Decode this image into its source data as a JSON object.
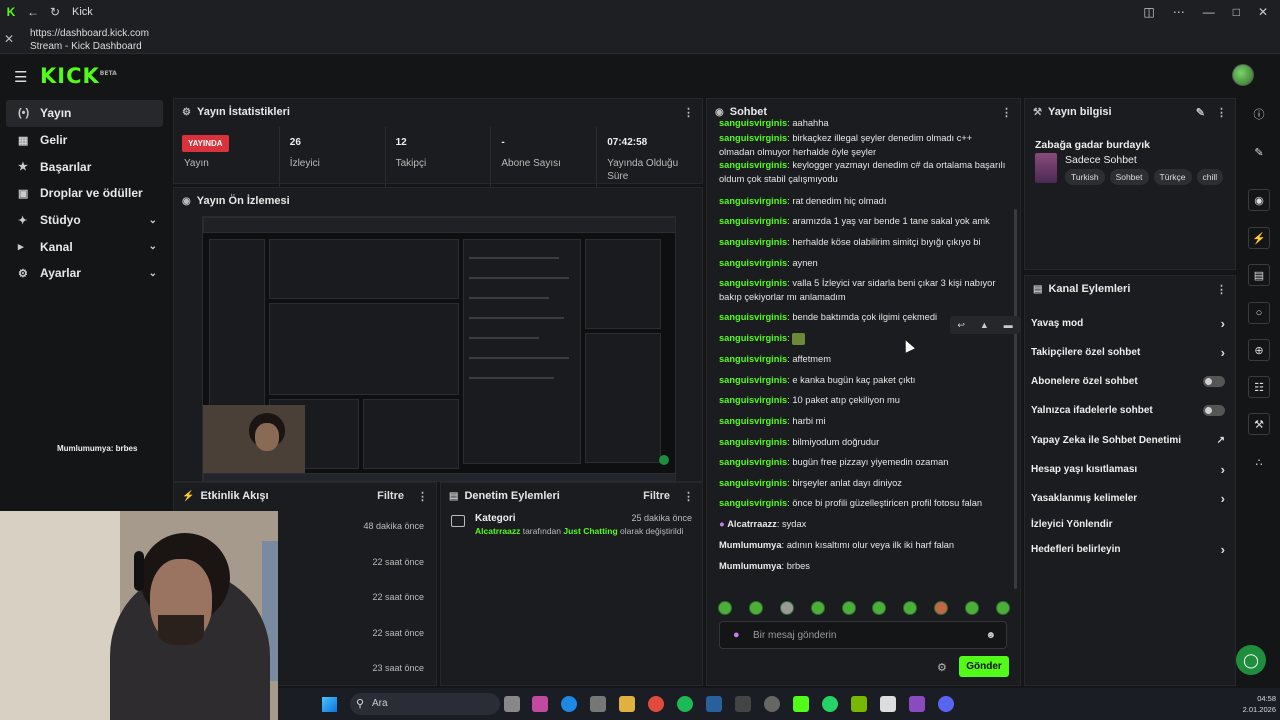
{
  "window": {
    "title": "Kick"
  },
  "address": {
    "url": "https://dashboard.kick.com",
    "page_title": "Stream - Kick Dashboard"
  },
  "brand": {
    "logo": "KICK",
    "logo_suffix": "BETA",
    "accent": "#53fc18"
  },
  "sidebar": {
    "items": [
      {
        "label": "Yayın",
        "icon": "broadcast-icon",
        "active": true
      },
      {
        "label": "Gelir",
        "icon": "money-icon"
      },
      {
        "label": "Başarılar",
        "icon": "trophy-icon"
      },
      {
        "label": "Droplar ve ödüller",
        "icon": "gift-icon"
      },
      {
        "label": "Stüdyo",
        "icon": "studio-icon",
        "expandable": true
      },
      {
        "label": "Kanal",
        "icon": "channel-icon",
        "expandable": true
      },
      {
        "label": "Ayarlar",
        "icon": "gear-icon",
        "expandable": true
      }
    ]
  },
  "overlay_text": "Mumlumumya: brbes",
  "stats_panel": {
    "title": "Yayın İstatistikleri",
    "live_badge": "YAYINDA",
    "stats": [
      {
        "value": "",
        "label": "Yayın"
      },
      {
        "value": "26",
        "label": "İzleyici"
      },
      {
        "value": "12",
        "label": "Takipçi"
      },
      {
        "value": "-",
        "label": "Abone Sayısı"
      },
      {
        "value": "07:42:58",
        "label": "Yayında Olduğu Süre"
      }
    ]
  },
  "preview_panel": {
    "title": "Yayın Ön İzlemesi"
  },
  "activity_panel": {
    "title": "Etkinlik Akışı",
    "filter": "Filtre",
    "times": [
      "48 dakika önce",
      "22 saat önce",
      "22 saat önce",
      "22 saat önce",
      "23 saat önce"
    ]
  },
  "moderation_panel": {
    "title": "Denetim Eylemleri",
    "filter": "Filtre",
    "item": {
      "name": "Kategori",
      "by": "Alcatrraazz",
      "middle": " tarafından ",
      "value": "Just Chatting",
      "suffix": " olarak değiştirildi",
      "time": "25 dakika önce"
    }
  },
  "chat_panel": {
    "title": "Sohbet",
    "messages": [
      {
        "user": "sanguisvirginis",
        "text": "aahahha"
      },
      {
        "user": "sanguisvirginis",
        "text": "birkaçkez illegal şeyler denedim olmadı c++ olmadan olmuyor herhalde öyle şeyler"
      },
      {
        "user": "sanguisvirginis",
        "text": "keylogger yazmayı denedim c# da ortalama başarılı oldum çok stabil çalışmıyodu"
      },
      {
        "user": "sanguisvirginis",
        "text": "rat denedim hiç olmadı"
      },
      {
        "user": "sanguisvirginis",
        "text": "aramızda 1 yaş var bende 1 tane sakal yok amk"
      },
      {
        "user": "sanguisvirginis",
        "text": "herhalde köse olabilirim simitçi bıyığı çıkıyo bi"
      },
      {
        "user": "sanguisvirginis",
        "text": "aynen"
      },
      {
        "user": "sanguisvirginis",
        "text": "valla 5 İzleyici var sidarla beni çıkar 3 kişi nabıyor bakıp çekiyorlar mı anlamadım"
      },
      {
        "user": "sanguisvirginis",
        "text": "bende baktımda çok ilgimi çekmedi"
      },
      {
        "user": "sanguisvirginis",
        "text": ""
      },
      {
        "user": "sanguisvirginis",
        "text": "affetmem"
      },
      {
        "user": "sanguisvirginis",
        "text": "e kanka bugün kaç paket çıktı"
      },
      {
        "user": "sanguisvirginis",
        "text": "10 paket atıp çekiliyon mu"
      },
      {
        "user": "sanguisvirginis",
        "text": "harbi mi"
      },
      {
        "user": "sanguisvirginis",
        "text": "bilmiyodum doğrudur"
      },
      {
        "user": "sanguisvirginis",
        "text": "bugün free pizzayı yiyemedin ozaman"
      },
      {
        "user": "sanguisvirginis",
        "text": "birşeyler anlat dayı diniyoz"
      },
      {
        "user": "sanguisvirginis",
        "text": "önce bi profili güzelleştiricen profil fotosu falan"
      },
      {
        "user": "Alcatrraazz",
        "text": "sydax"
      },
      {
        "user": "Mumlumumya",
        "text": "adının kısaltımı olur veya ilk iki harf falan"
      },
      {
        "user": "Mumlumumya",
        "text": "brbes"
      }
    ],
    "input_placeholder": "Bir mesaj gönderin",
    "send_label": "Gönder"
  },
  "info_panel": {
    "title": "Yayın bilgisi",
    "stream_title": "Zabağa gadar burdayık",
    "category": "Sadece Sohbet",
    "tags": [
      "Turkish",
      "Sohbet",
      "Türkçe",
      "chill"
    ]
  },
  "actions_panel": {
    "title": "Kanal Eylemleri",
    "items": [
      {
        "label": "Yavaş mod",
        "kind": "arrow"
      },
      {
        "label": "Takipçilere özel sohbet",
        "kind": "arrow"
      },
      {
        "label": "Abonelere özel sohbet",
        "kind": "toggle"
      },
      {
        "label": "Yalnızca ifadelerle sohbet",
        "kind": "toggle"
      },
      {
        "label": "Yapay Zeka ile Sohbet Denetimi",
        "kind": "external"
      },
      {
        "label": "Hesap yaşı kısıtlaması",
        "kind": "arrow"
      },
      {
        "label": "Yasaklanmış kelimeler",
        "kind": "arrow"
      },
      {
        "label": "İzleyici Yönlendir",
        "kind": "none"
      },
      {
        "label": "Hedefleri belirleyin",
        "kind": "arrow"
      }
    ]
  },
  "taskbar": {
    "search": "Ara",
    "time": "04:58",
    "date": "2.01.2026"
  }
}
